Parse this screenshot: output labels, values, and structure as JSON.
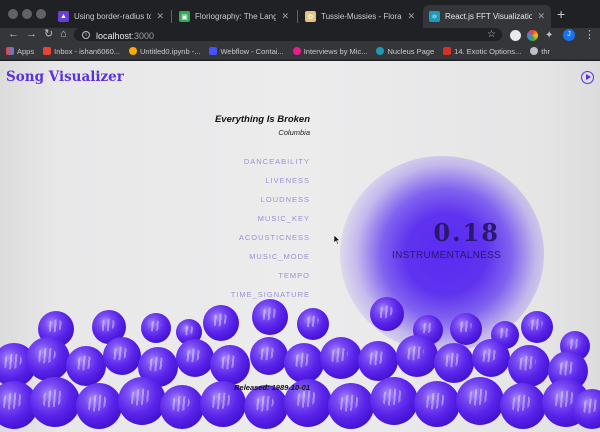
{
  "browser": {
    "tabs": [
      {
        "title": "Using border-radius to make",
        "favicon_color": "#6b3fd4",
        "active": false
      },
      {
        "title": "Floriography: The Language",
        "favicon_color": "#34a853",
        "active": false
      },
      {
        "title": "Tussie-Mussies - Floral Des",
        "favicon_color": "#e8c27a",
        "active": false
      },
      {
        "title": "React.js FFT Visualization",
        "favicon_color": "#1e9bb8",
        "active": true
      }
    ],
    "new_tab_label": "+",
    "url_host": "localhost",
    "url_port": ":3000",
    "profile_initial": "J",
    "bookmarks": [
      {
        "label": "Apps",
        "color": "#e94235"
      },
      {
        "label": "Inbox - ishan6060...",
        "color": "#ea4335"
      },
      {
        "label": "Untitled0.ipynb -...",
        "color": "#f9ab00"
      },
      {
        "label": "Webflow - Contai...",
        "color": "#4353ff"
      },
      {
        "label": "Interviews by Mic...",
        "color": "#e91e8c"
      },
      {
        "label": "Nucleus Page",
        "color": "#1e9bb8"
      },
      {
        "label": "14. Exotic Options...",
        "color": "#d93025"
      },
      {
        "label": "thr",
        "color": "#bdc1c6"
      }
    ]
  },
  "app": {
    "title": "Song Visualizer",
    "song_name": "Everything Is Broken",
    "artist": "Columbia",
    "features": [
      "DANCEABILITY",
      "LIVENESS",
      "LOUDNESS",
      "MUSIC_KEY",
      "ACOUSTICNESS",
      "MUSIC_MODE",
      "TEMPO",
      "TIME_SIGNATURE"
    ],
    "selected_value": "0.18",
    "selected_metric": "INSTRUMENTALNESS",
    "released": "Released: 1989-10-01",
    "accent_color": "#5b30e0"
  }
}
